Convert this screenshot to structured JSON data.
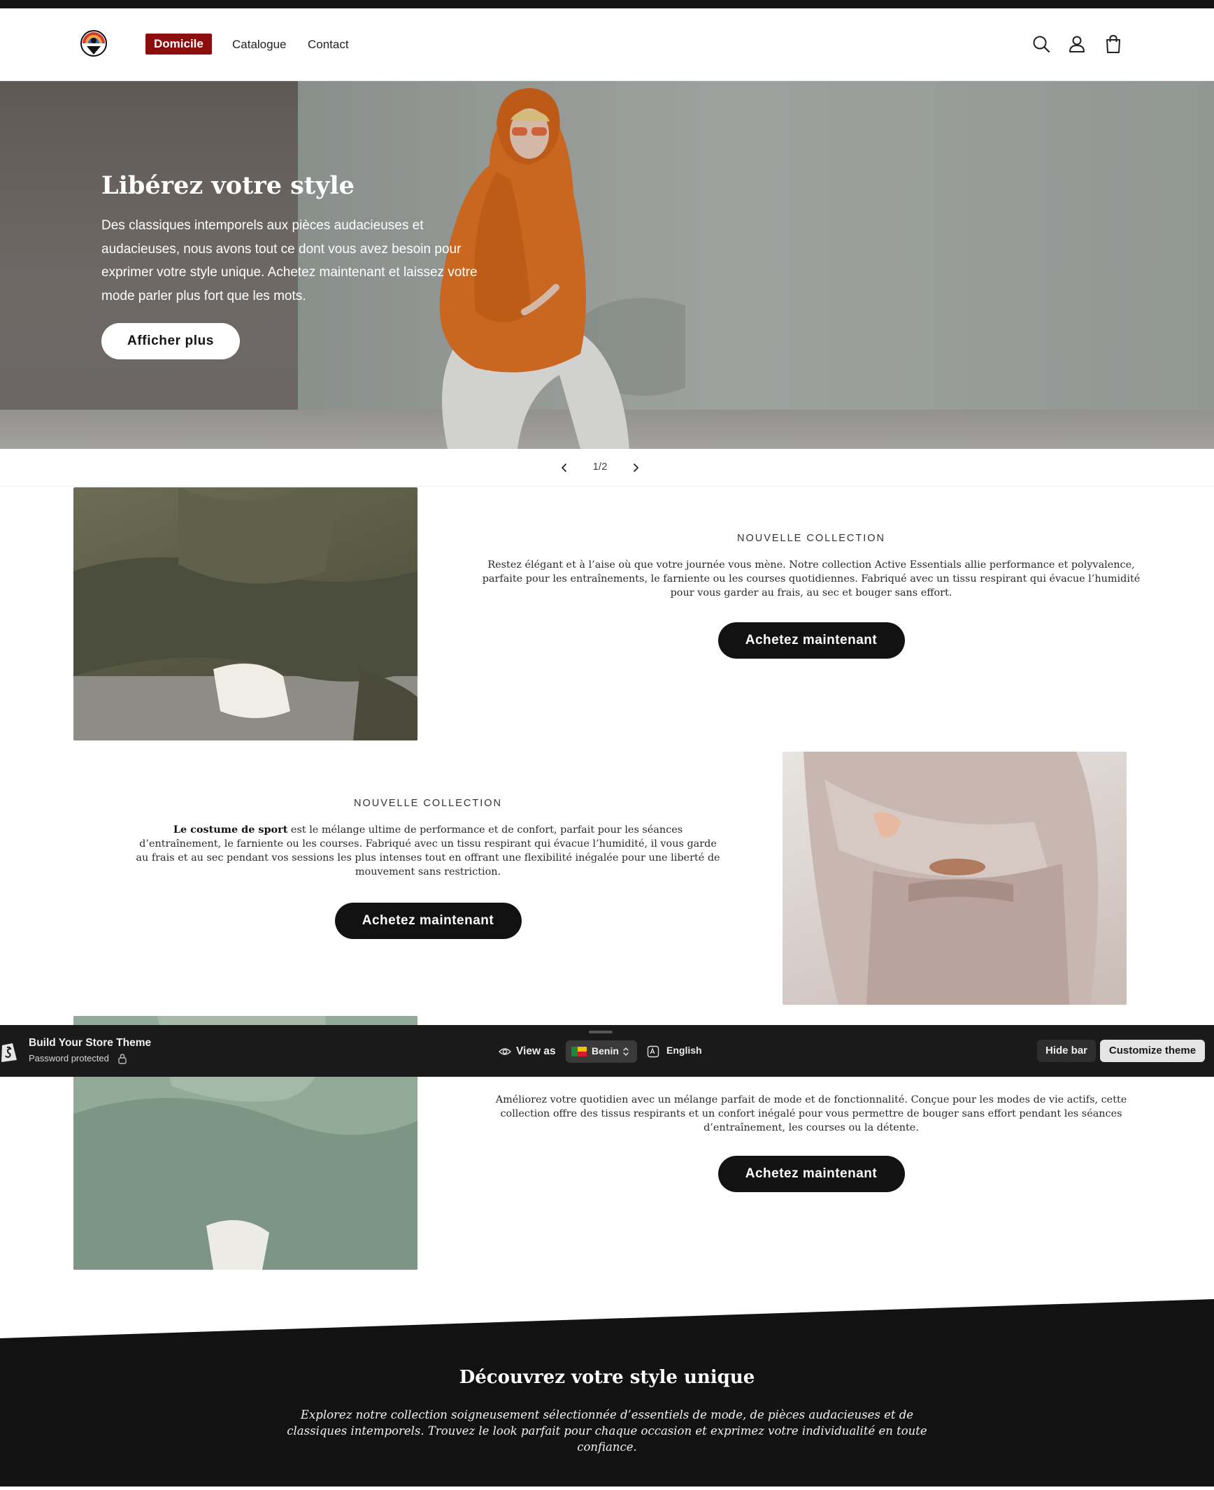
{
  "header": {
    "nav": [
      "Domicile",
      "Catalogue",
      "Contact"
    ],
    "icons": [
      "search-icon",
      "account-icon",
      "cart-icon"
    ]
  },
  "hero": {
    "title": "Libérez votre style",
    "text": "Des classiques intemporels aux pièces audacieuses et audacieuses, nous avons tout ce dont vous avez besoin pour exprimer votre style unique. Achetez maintenant et laissez votre mode parler plus fort que les mots.",
    "button": "Afficher plus",
    "slide_counter": "1/2"
  },
  "sections": [
    {
      "eyebrow": "NOUVELLE COLLECTION",
      "text": "Restez élégant et à l’aise où que votre journée vous mène. Notre collection Active Essentials allie performance et polyvalence, parfaite pour les entraînements, le farniente ou les courses quotidiennes. Fabriqué avec un tissu respirant qui évacue l’humidité pour vous garder au frais, au sec et bouger sans effort.",
      "button": "Achetez maintenant"
    },
    {
      "eyebrow": "NOUVELLE COLLECTION",
      "bold": "Le costume de sport",
      "text": " est le mélange ultime de performance et de confort, parfait pour les séances d’entraînement, le farniente ou les courses. Fabriqué avec un tissu respirant qui évacue l’humidité, il vous garde au frais et au sec pendant vos sessions les plus intenses tout en offrant une flexibilité inégalée pour une liberté de mouvement sans restriction.",
      "button": "Achetez maintenant"
    },
    {
      "text": "Améliorez votre quotidien avec un mélange parfait de mode et de fonctionnalité. Conçue pour les modes de vie actifs, cette collection offre des tissus respirants et un confort inégalé pour vous permettre de bouger sans effort pendant les séances d’entraînement, les courses ou la détente.",
      "button": "Achetez maintenant"
    }
  ],
  "preview_bar": {
    "store_name": "Build Your Store Theme",
    "status": "Password protected",
    "view_as": "View as",
    "country": "Benin",
    "language": "English",
    "hide_bar": "Hide bar",
    "customize": "Customize theme"
  },
  "footer_band": {
    "title": "Découvrez votre style unique",
    "text": "Explorez notre collection soigneusement sélectionnée d’essentiels de mode, de pièces audacieuses et de classiques intemporels. Trouvez le look parfait pour chaque occasion et exprimez votre individualité en toute confiance."
  },
  "colors": {
    "accent": "#8b0d0d",
    "dark": "#121212",
    "preview_bar": "#1a1a1a"
  }
}
